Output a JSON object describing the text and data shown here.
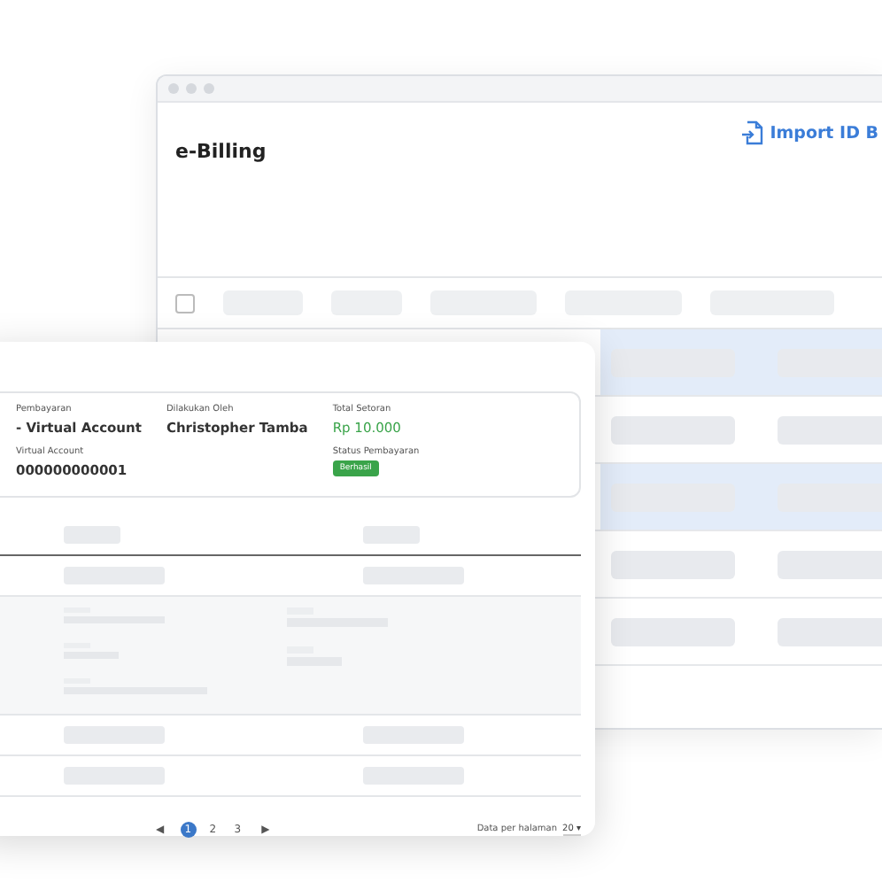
{
  "back_window": {
    "title": "e-Billing",
    "import_button": "Import ID B",
    "select_all_checked": false,
    "rows": [
      {
        "highlighted": true
      },
      {
        "highlighted": false
      },
      {
        "highlighted": true
      },
      {
        "highlighted": false
      },
      {
        "highlighted": false
      }
    ]
  },
  "detail_card": {
    "fields": [
      {
        "label": "Pembayaran",
        "value": "- Virtual Account",
        "kind": "text"
      },
      {
        "label": "Virtual Account",
        "value": "000000000001",
        "kind": "text"
      },
      {
        "label": "Dilakukan Oleh",
        "value": "Christopher Tamba",
        "kind": "text"
      },
      {
        "label": "Total Setoran",
        "value": "Rp 10.000",
        "kind": "amount"
      },
      {
        "label": "Status Pembayaran",
        "value": "Berhasil",
        "kind": "badge"
      }
    ],
    "pagination": {
      "prev": "◀",
      "next": "▶",
      "pages": [
        {
          "label": "1",
          "selected": true
        },
        {
          "label": "2",
          "selected": false
        },
        {
          "label": "3",
          "selected": false
        }
      ]
    },
    "per_page_label": "Data per halaman",
    "per_page_value": "20 ▾"
  }
}
